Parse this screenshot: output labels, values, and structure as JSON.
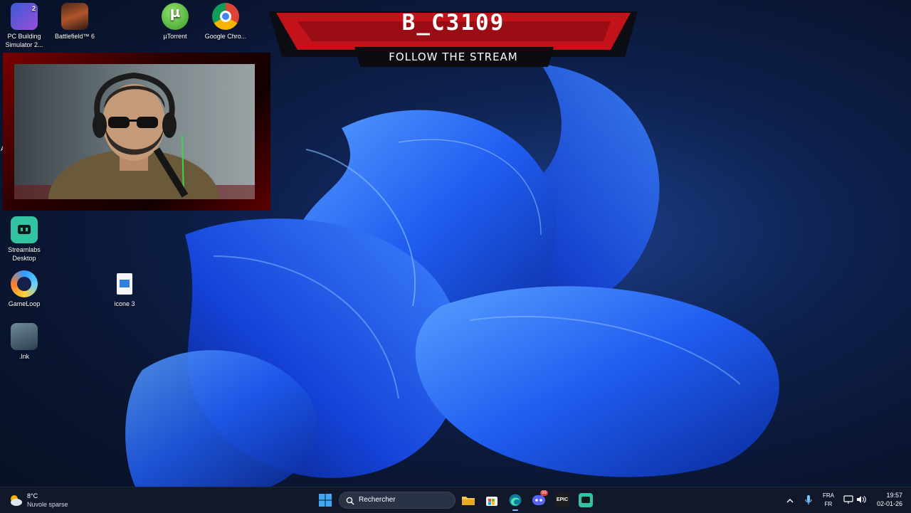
{
  "desktop": {
    "icons": [
      {
        "label": "PC Building Simulator 2..."
      },
      {
        "label": "Battlefield™ 6"
      },
      {
        "label": "µTorrent"
      },
      {
        "label": "Google Chro..."
      },
      {
        "label": "Streamlabs Desktop"
      },
      {
        "label": "GameLoop"
      },
      {
        "label": "icone 3"
      },
      {
        "label": ".lnk"
      }
    ],
    "stray_text": "Ar"
  },
  "overlay": {
    "streamer_name": "B_C3109",
    "follow_text": "FOLLOW THE STREAM",
    "accent_color": "#c4121a"
  },
  "taskbar": {
    "weather": {
      "temp": "8°C",
      "condition": "Nuvole sparse"
    },
    "search_placeholder": "Rechercher",
    "discord_badge": "99",
    "epic_label": "EPIC",
    "tray": {
      "lang_top": "FRA",
      "lang_bottom": "FR"
    },
    "clock": {
      "time": "19:57",
      "date": "02-01-26"
    }
  }
}
